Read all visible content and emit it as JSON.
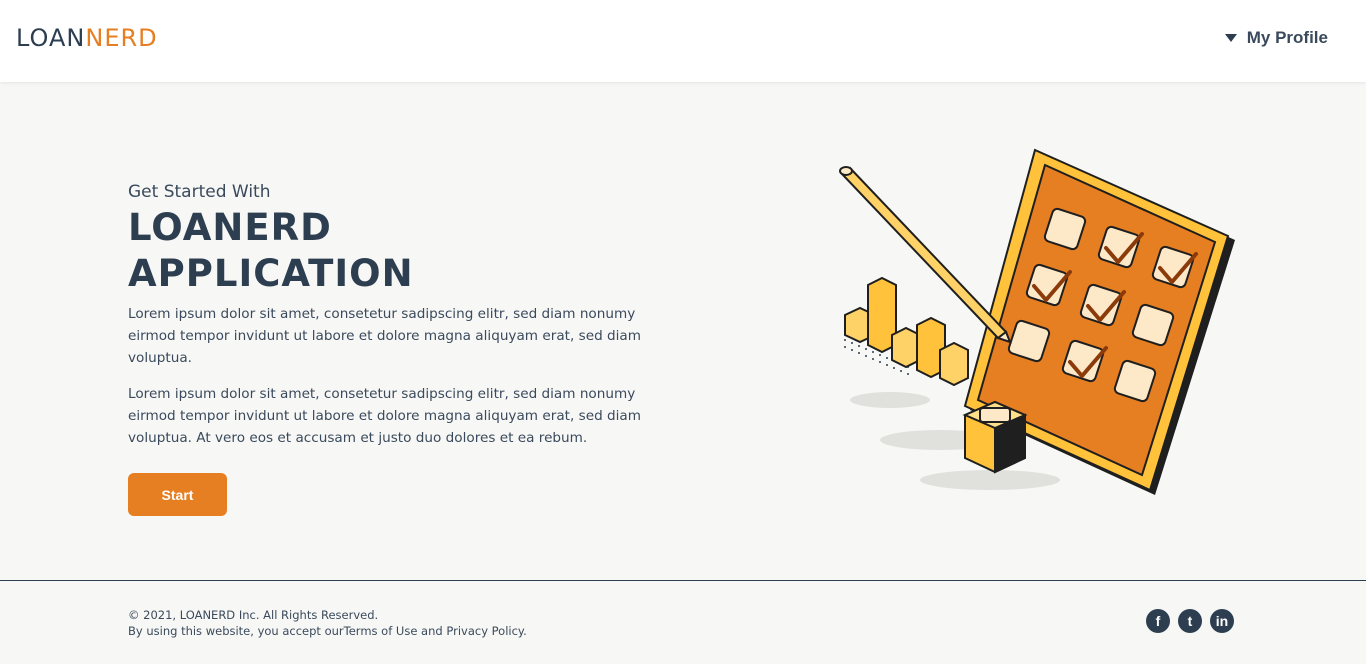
{
  "header": {
    "logo_part1": "LOAN",
    "logo_part2": "ERD",
    "logo_mid": "N",
    "profile_label": "My Profile"
  },
  "hero": {
    "kicker": "Get Started With",
    "title_line1": "LOANERD",
    "title_line2": "APPLICATION",
    "paragraph1": "Lorem ipsum dolor sit amet, consetetur sadipscing elitr, sed diam nonumy eirmod tempor invidunt ut labore et dolore magna aliquyam erat, sed diam voluptua.",
    "paragraph2": "Lorem ipsum dolor sit amet, consetetur sadipscing elitr, sed diam nonumy eirmod tempor invidunt ut labore et dolore magna aliquyam erat, sed diam voluptua. At vero eos et accusam et justo duo dolores et ea rebum.",
    "start_label": "Start"
  },
  "footer": {
    "copyright": "© 2021, LOANERD Inc. All Rights Reserved.",
    "accept_prefix": "By using this website, you accept our",
    "terms_label": "Terms of Use",
    "and": " and ",
    "privacy_label": "Privacy Policy",
    "period": "."
  },
  "social": [
    {
      "name": "facebook-icon",
      "glyph": "f"
    },
    {
      "name": "twitter-icon",
      "glyph": "t"
    },
    {
      "name": "linkedin-icon",
      "glyph": "in"
    }
  ],
  "colors": {
    "brand_dark": "#2c3e50",
    "brand_orange": "#e67e22",
    "background": "#f7f7f5"
  }
}
